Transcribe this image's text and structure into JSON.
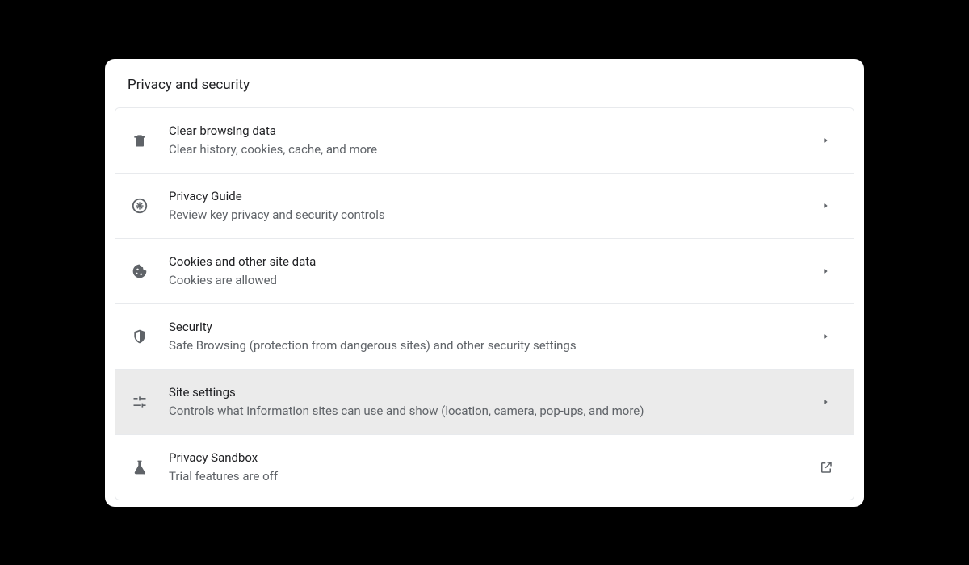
{
  "section": {
    "title": "Privacy and security",
    "items": [
      {
        "title": "Clear browsing data",
        "subtitle": "Clear history, cookies, cache, and more"
      },
      {
        "title": "Privacy Guide",
        "subtitle": "Review key privacy and security controls"
      },
      {
        "title": "Cookies and other site data",
        "subtitle": "Cookies are allowed"
      },
      {
        "title": "Security",
        "subtitle": "Safe Browsing (protection from dangerous sites) and other security settings"
      },
      {
        "title": "Site settings",
        "subtitle": "Controls what information sites can use and show (location, camera, pop-ups, and more)"
      },
      {
        "title": "Privacy Sandbox",
        "subtitle": "Trial features are off"
      }
    ]
  }
}
